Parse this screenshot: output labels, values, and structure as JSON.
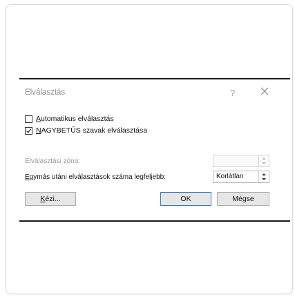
{
  "dialog": {
    "title": "Elválasztás",
    "help_symbol": "?",
    "checkboxes": [
      {
        "label_underlined": "A",
        "label_rest": "utomatikus elválasztás",
        "checked": false
      },
      {
        "label_underlined": "N",
        "label_rest": "AGYBETŰS szavak elválasztása",
        "checked": true
      }
    ],
    "zone_label": "Elválasztási zóna:",
    "zone_value": "",
    "limit_label_underlined": "E",
    "limit_label_rest": "gymás utáni elválasztások száma legfeljebb:",
    "limit_value": "Korlátlan",
    "buttons": {
      "manual_underlined": "K",
      "manual_rest": "ézi...",
      "ok": "OK",
      "cancel": "Mégse"
    }
  },
  "icons": [
    "close-icon",
    "checkmark-icon",
    "spin-up-icon",
    "spin-down-icon"
  ],
  "colors": {
    "accent": "#2f77d1",
    "button_bg": "#e6e6e6",
    "disabled_text": "#9a9a9a"
  }
}
